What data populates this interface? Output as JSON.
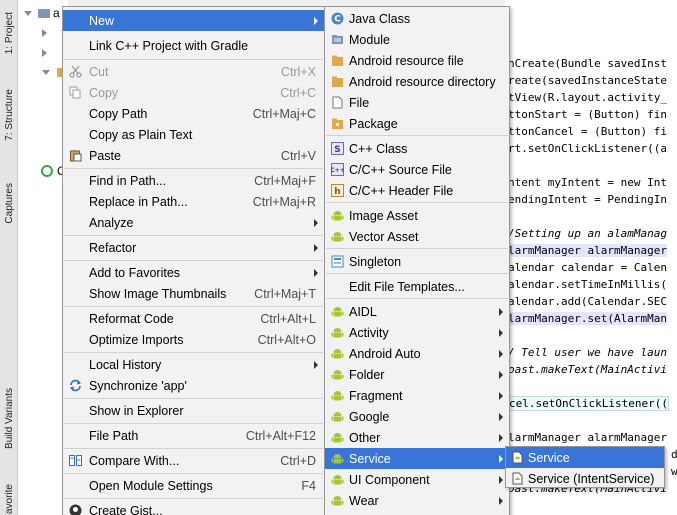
{
  "toolstrip": {
    "tabs": [
      {
        "label": "1: Project"
      },
      {
        "label": "7: Structure"
      },
      {
        "label": "Captures"
      },
      {
        "label": "Build Variants"
      },
      {
        "label": "Favorites"
      }
    ]
  },
  "tree": {
    "root_label": "a",
    "child_label": "C"
  },
  "editor": {
    "lines": [
      "nCreate(Bundle savedInst",
      "reate(savedInstanceState",
      "tView(R.layout.activity_",
      "ttonStart = (Button) fin",
      "ttonCancel = (Button) fi",
      "rt.setOnClickListener((a",
      "ntent myIntent = new Int",
      "endingIntent = PendingIn",
      "/Setting up an alamManag",
      "larmManager alarmManager",
      "alendar calendar = Calen",
      "alendar.setTimeInMillis(",
      "alendar.add(Calendar.SEC",
      "larmManager.set(AlarmMan",
      "/ Tell user we have laun",
      "oast.makeText(MainActivi",
      "cel.setOnClickListener((",
      "larmManager alarmManager",
      "di",
      "wh",
      "oast.makeText(MainActivi"
    ]
  },
  "menu_main": {
    "items": [
      {
        "label": "New",
        "shortcut": "",
        "submenu": true,
        "selected": true,
        "disabled": false,
        "icon": ""
      },
      {
        "label": "Link C++ Project with Gradle",
        "shortcut": "",
        "icon": ""
      },
      {
        "label": "Cut",
        "shortcut": "Ctrl+X",
        "disabled": true,
        "icon": "scissors-icon"
      },
      {
        "label": "Copy",
        "shortcut": "Ctrl+C",
        "disabled": true,
        "icon": "copy-icon"
      },
      {
        "label": "Copy Path",
        "shortcut": "Ctrl+Maj+C",
        "icon": ""
      },
      {
        "label": "Copy as Plain Text",
        "shortcut": "",
        "icon": ""
      },
      {
        "label": "Paste",
        "shortcut": "Ctrl+V",
        "icon": "paste-icon"
      },
      {
        "label": "Find in Path...",
        "shortcut": "Ctrl+Maj+F",
        "icon": ""
      },
      {
        "label": "Replace in Path...",
        "shortcut": "Ctrl+Maj+R",
        "icon": ""
      },
      {
        "label": "Analyze",
        "shortcut": "",
        "submenu": true,
        "icon": ""
      },
      {
        "label": "Refactor",
        "shortcut": "",
        "submenu": true,
        "icon": ""
      },
      {
        "label": "Add to Favorites",
        "shortcut": "",
        "submenu": true,
        "icon": ""
      },
      {
        "label": "Show Image Thumbnails",
        "shortcut": "Ctrl+Maj+T",
        "icon": ""
      },
      {
        "label": "Reformat Code",
        "shortcut": "Ctrl+Alt+L",
        "icon": ""
      },
      {
        "label": "Optimize Imports",
        "shortcut": "Ctrl+Alt+O",
        "icon": ""
      },
      {
        "label": "Local History",
        "shortcut": "",
        "submenu": true,
        "icon": ""
      },
      {
        "label": "Synchronize 'app'",
        "shortcut": "",
        "icon": "sync-icon"
      },
      {
        "label": "Show in Explorer",
        "shortcut": "",
        "icon": ""
      },
      {
        "label": "File Path",
        "shortcut": "Ctrl+Alt+F12",
        "icon": ""
      },
      {
        "label": "Compare With...",
        "shortcut": "Ctrl+D",
        "icon": "compare-icon"
      },
      {
        "label": "Open Module Settings",
        "shortcut": "F4",
        "icon": ""
      },
      {
        "label": "Create Gist...",
        "shortcut": "",
        "icon": "github-icon"
      }
    ]
  },
  "menu_new": {
    "items": [
      {
        "label": "Java Class",
        "icon": "java-class-icon"
      },
      {
        "label": "Module",
        "icon": "module-icon"
      },
      {
        "label": "Android resource file",
        "icon": "android-resource-file-icon"
      },
      {
        "label": "Android resource directory",
        "icon": "folder-icon"
      },
      {
        "label": "File",
        "icon": "file-icon"
      },
      {
        "label": "Package",
        "icon": "package-icon"
      },
      {
        "label": "C++ Class",
        "icon": "cpp-class-icon"
      },
      {
        "label": "C/C++ Source File",
        "icon": "cpp-source-icon"
      },
      {
        "label": "C/C++ Header File",
        "icon": "cpp-header-icon"
      },
      {
        "label": "Image Asset",
        "icon": "android-icon"
      },
      {
        "label": "Vector Asset",
        "icon": "android-icon"
      },
      {
        "label": "Singleton",
        "icon": "singleton-icon"
      },
      {
        "label": "Edit File Templates...",
        "icon": ""
      },
      {
        "label": "AIDL",
        "icon": "android-icon",
        "submenu": true
      },
      {
        "label": "Activity",
        "icon": "android-icon",
        "submenu": true
      },
      {
        "label": "Android Auto",
        "icon": "android-icon",
        "submenu": true
      },
      {
        "label": "Folder",
        "icon": "android-icon",
        "submenu": true
      },
      {
        "label": "Fragment",
        "icon": "android-icon",
        "submenu": true
      },
      {
        "label": "Google",
        "icon": "android-icon",
        "submenu": true
      },
      {
        "label": "Other",
        "icon": "android-icon",
        "submenu": true
      },
      {
        "label": "Service",
        "icon": "android-icon",
        "submenu": true,
        "selected": true
      },
      {
        "label": "UI Component",
        "icon": "android-icon",
        "submenu": true
      },
      {
        "label": "Wear",
        "icon": "android-icon",
        "submenu": true
      }
    ]
  },
  "menu_service": {
    "items": [
      {
        "label": "Service",
        "selected": true,
        "icon": "service-file-icon"
      },
      {
        "label": "Service (IntentService)",
        "icon": "service-file-icon"
      }
    ]
  },
  "colors": {
    "selection": "#3875d7",
    "android_green": "#a4c639",
    "menu_bg": "#f2f2f2"
  }
}
